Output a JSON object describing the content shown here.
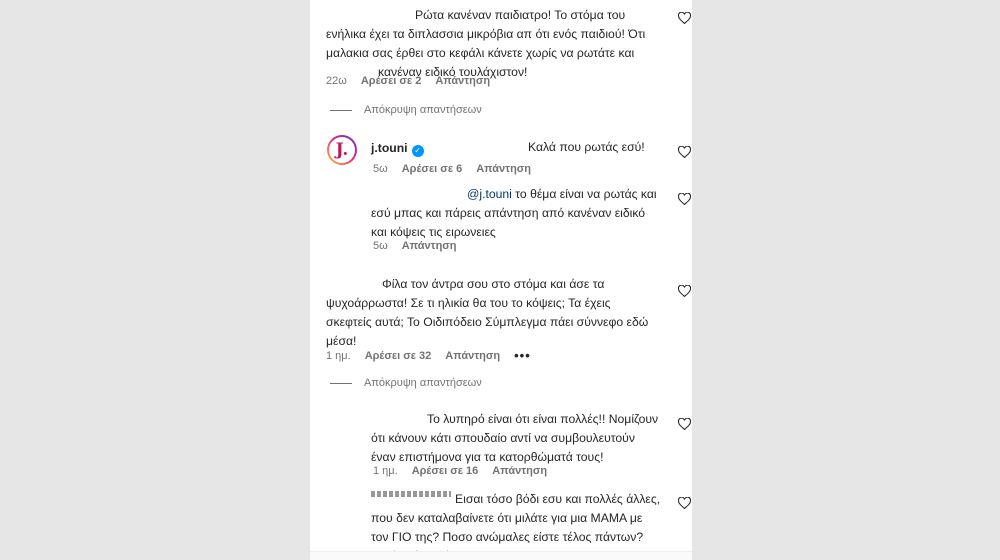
{
  "comments": [
    {
      "text_lines": [
        "Ρώτα κανέναν παιδιατρο! Το στόμα του",
        "ενήλικα έχει τα διπλασσια μικρόβια απ ότι ενός παιδιού! Ότι",
        "μαλακια σας έρθει στο κεφάλι κάνετε χωρίς να ρωτάτε και",
        "κανέναν ειδικό τουλάχιστον!"
      ],
      "time": "22ω",
      "likes": "Αρέσει σε 2",
      "reply": "Απάντηση"
    },
    {
      "username": "j.touni",
      "avatar_letter": "J.",
      "text": "Καλά που ρωτάς εσύ!",
      "time": "5ω",
      "likes": "Αρέσει σε 6",
      "reply": "Απάντηση"
    },
    {
      "mention": "@j.touni",
      "text_first": " το θέμα είναι να ρωτάς και",
      "text_lines": [
        "εσύ μπας και πάρεις απάντηση από κανέναν ειδικό",
        "και κόψεις τις ειρωνειες"
      ],
      "time": "5ω",
      "reply": "Απάντηση"
    },
    {
      "text_lines": [
        "Φίλα τον άντρα σου στο στόμα και άσε τα",
        "ψυχοάρρωστα! Σε τι ηλικία θα του το κόψεις; Τα έχεις",
        "σκεφτείς αυτά; Το Οιδιπόδειο Σύμπλεγμα πάει σύννεφο εδώ",
        "μέσα!"
      ],
      "time": "1 ημ.",
      "likes": "Αρέσει σε 32",
      "reply": "Απάντηση",
      "more": "•••"
    },
    {
      "text_lines": [
        "Το λυπηρό είναι ότι είναι πολλές!! Νομίζουν",
        "ότι κάνουν κάτι σπουδαίο αντί να συμβουλευτούν",
        "έναν επιστήμονα για τα κατορθώματά τους!"
      ],
      "time": "1 ημ.",
      "likes": "Αρέσει σε 16",
      "reply": "Απάντηση"
    },
    {
      "text_lines": [
        "Εισαι τόσο βόδι εσυ και πολλές άλλες,",
        "που δεν καταλαβαίνετε ότι μιλάτε για μια ΜΑΜΑ με",
        "τον ΓΙΟ της? Ποσο ανώμαλες είστε τέλος πάντων?",
        "Για όλα έχετε έτοιμη την χολή σας για να την"
      ]
    }
  ],
  "hide_replies": "Απόκρυψη απαντήσεων"
}
